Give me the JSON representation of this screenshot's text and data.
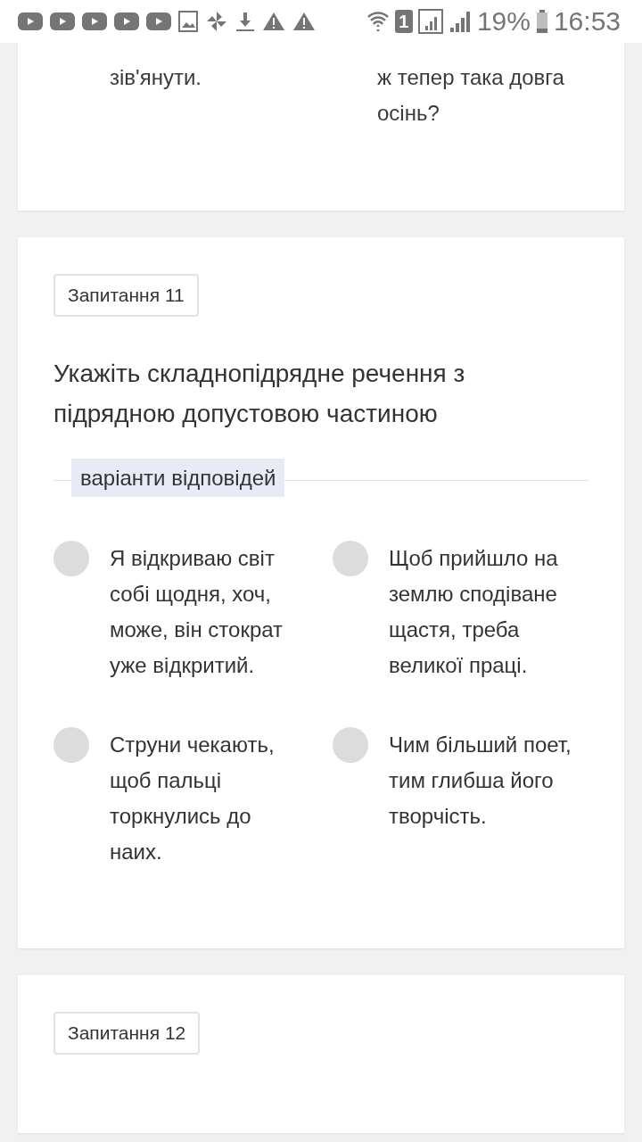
{
  "status_bar": {
    "sim": "1",
    "battery": "19%",
    "time": "16:53"
  },
  "previous_question": {
    "options": [
      {
        "text": "зів'янути."
      },
      {
        "text": "ж тепер така довга осінь?"
      }
    ]
  },
  "questions": [
    {
      "badge": "Запитання 11",
      "text": "Укажіть складнопідрядне речення з підрядною допустовою частиною",
      "answers_label": "варіанти відповідей",
      "options": [
        {
          "text": "Я відкриваю світ собі щодня, хоч, може, він стократ уже відкритий.",
          "selected": false
        },
        {
          "text": "Щоб прийшло на землю сподіване щастя, треба великої праці.",
          "selected": false
        },
        {
          "text": "Струни чекають, щоб пальці торкнулись до наих.",
          "selected": false
        },
        {
          "text": "Чим більший поет, тим глибша його творчість.",
          "selected": false
        }
      ]
    },
    {
      "badge": "Запитання 12"
    }
  ]
}
